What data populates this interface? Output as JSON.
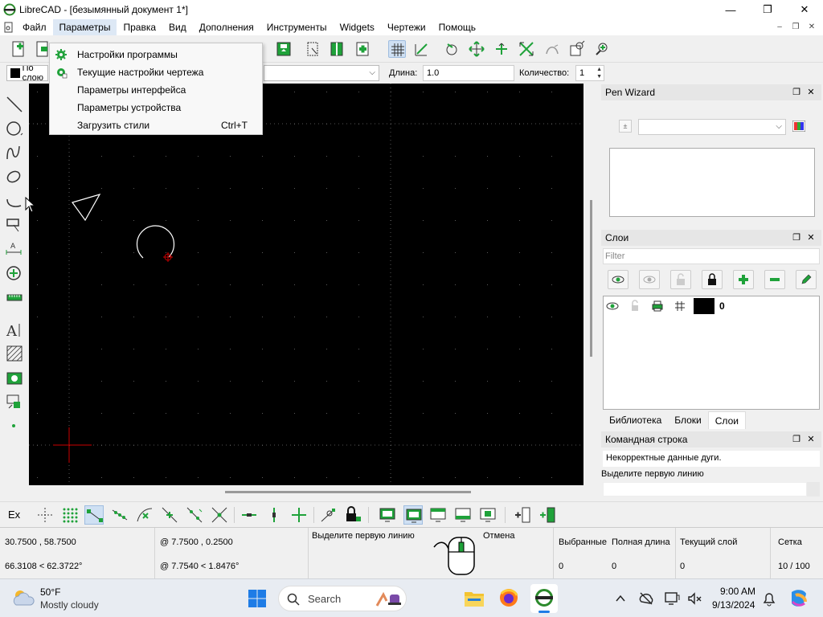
{
  "window": {
    "title": "LibreCAD - [безымянный документ 1*]",
    "minimize": "—",
    "maximize": "❐",
    "close": "✕"
  },
  "menubar": {
    "items": [
      "Файл",
      "Параметры",
      "Правка",
      "Вид",
      "Дополнения",
      "Инструменты",
      "Widgets",
      "Чертежи",
      "Помощь"
    ],
    "active": "Параметры"
  },
  "dropdown": {
    "items": [
      {
        "label": "Настройки программы",
        "shortcut": "",
        "icon": "gear-icon"
      },
      {
        "label": "Текущие настройки чертежа",
        "shortcut": "",
        "icon": "drawing-settings-icon"
      },
      {
        "label": "Параметры интерфейса",
        "shortcut": ""
      },
      {
        "label": "Параметры устройства",
        "shortcut": ""
      },
      {
        "label": "Загрузить стили",
        "shortcut": "Ctrl+T"
      }
    ]
  },
  "tooloptions": {
    "pen_label": "По слою",
    "length_label": "Длина:",
    "length_value": "1.0",
    "count_label": "Количество:",
    "count_value": "1"
  },
  "pen_wizard": {
    "title": "Pen Wizard"
  },
  "layers": {
    "title": "Слои",
    "filter_placeholder": "Filter",
    "rows": [
      {
        "name": "0",
        "color": "#000000"
      }
    ],
    "tabs": [
      "Библиотека",
      "Блоки",
      "Слои"
    ],
    "active_tab": "Слои"
  },
  "command": {
    "title": "Командная строка",
    "output": "Некорректные данные дуги.",
    "prompt": "Выделите первую линию"
  },
  "snapbar": {
    "ex_label": "Ex"
  },
  "status": {
    "abs_coord": "30.7500 , 58.7500",
    "abs_polar": "66.3108 < 62.3722°",
    "rel_coord": "@  7.7500 , 0.2500",
    "rel_polar": "@  7.7540 < 1.8476°",
    "left_mouse": "Выделите первую линию",
    "right_mouse": "Отмена",
    "selected_label": "Выбранные",
    "selected_value": "0",
    "total_length_label": "Полная длина",
    "total_length_value": "0",
    "current_layer_label": "Текущий слой",
    "current_layer_value": "0",
    "grid_label": "Сетка",
    "grid_value": "10 / 100"
  },
  "taskbar": {
    "temperature": "50°F",
    "weather": "Mostly cloudy",
    "search": "Search",
    "time": "9:00 AM",
    "date": "9/13/2024"
  },
  "colors": {
    "canvas_bg": "#000000",
    "grid_dot": "#5a5a5a",
    "entity": "#ffffff",
    "crosshair": "#cc0000",
    "icon_green": "#1fa23a",
    "active_menu": "#dde8f5"
  }
}
